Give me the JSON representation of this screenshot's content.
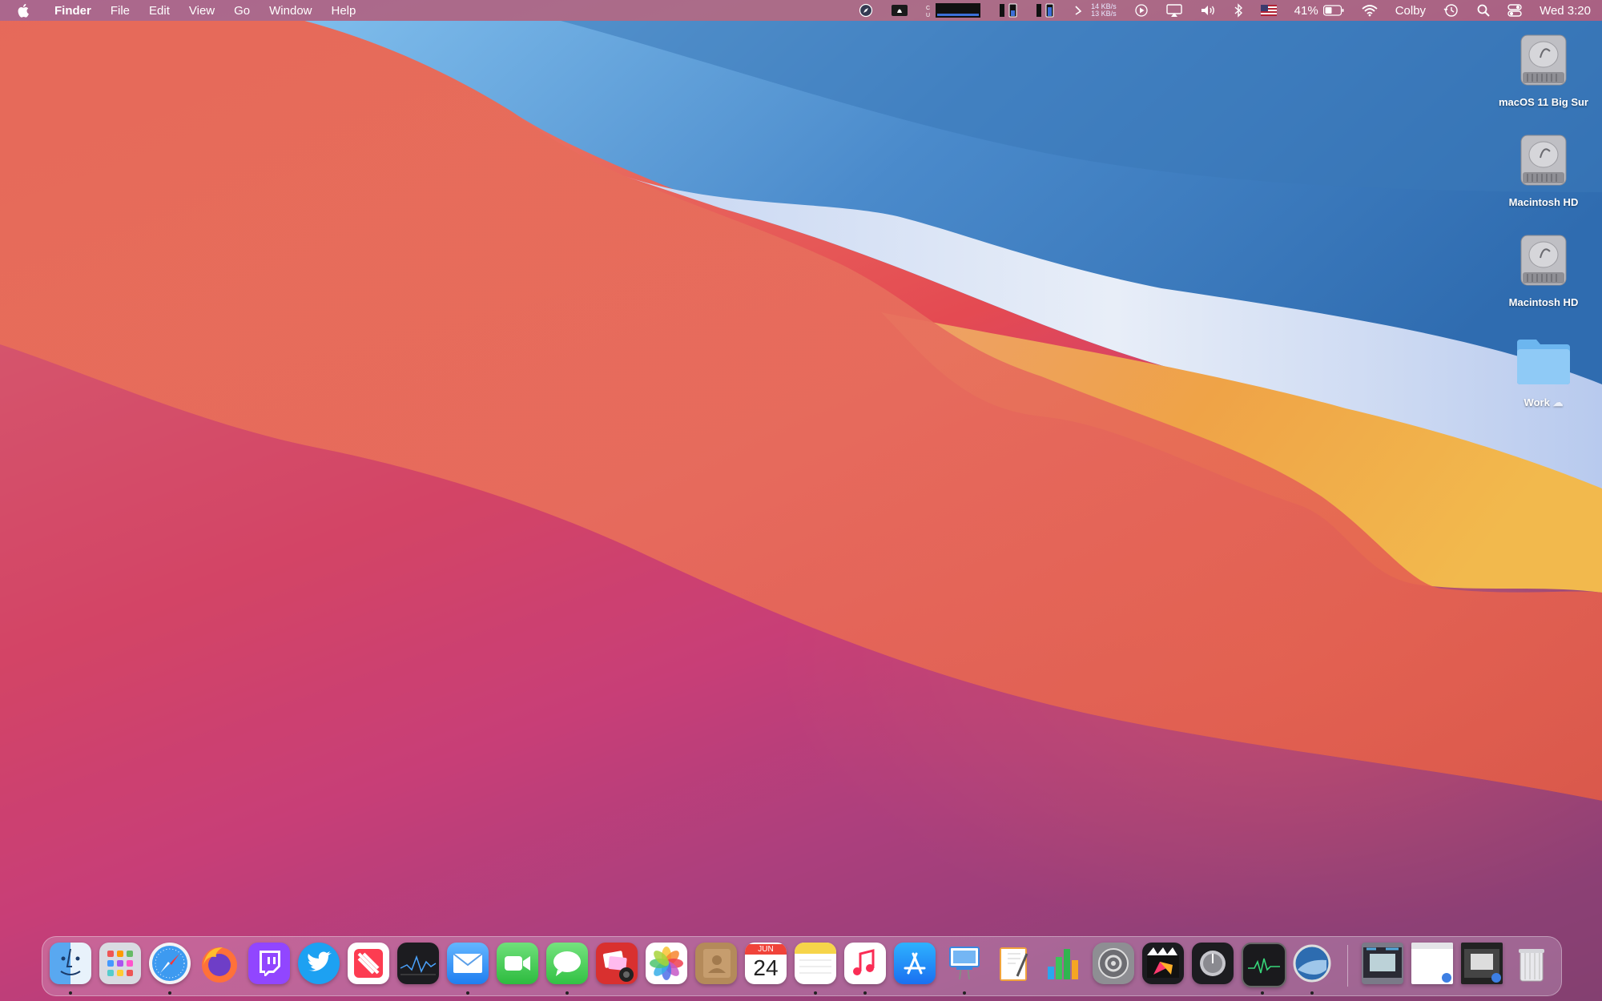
{
  "menubar": {
    "app_name": "Finder",
    "menus": [
      "File",
      "Edit",
      "View",
      "Go",
      "Window",
      "Help"
    ],
    "network_up": "14 KB/s",
    "network_down": "13 KB/s",
    "battery_percent": "41%",
    "user_name": "Colby",
    "clock": "Wed 3:20"
  },
  "desktop_icons": [
    {
      "label": "macOS 11 Big Sur",
      "icon": "hard-drive-icon"
    },
    {
      "label": "Macintosh HD",
      "icon": "hard-drive-icon"
    },
    {
      "label": "Macintosh HD",
      "icon": "hard-drive-icon"
    },
    {
      "label": "Work",
      "icon": "folder-icon"
    }
  ],
  "dock": {
    "apps": [
      {
        "name": "finder",
        "running": true
      },
      {
        "name": "launchpad",
        "running": false
      },
      {
        "name": "safari",
        "running": true
      },
      {
        "name": "firefox",
        "running": false
      },
      {
        "name": "twitch",
        "running": false
      },
      {
        "name": "twitter",
        "running": false
      },
      {
        "name": "news",
        "running": false
      },
      {
        "name": "stocks",
        "running": false
      },
      {
        "name": "mail",
        "running": true
      },
      {
        "name": "facetime",
        "running": false
      },
      {
        "name": "messages",
        "running": true
      },
      {
        "name": "photo-booth",
        "running": false
      },
      {
        "name": "photos",
        "running": false
      },
      {
        "name": "contacts",
        "running": false
      },
      {
        "name": "calendar",
        "running": false
      },
      {
        "name": "notes",
        "running": true
      },
      {
        "name": "music",
        "running": true
      },
      {
        "name": "app-store",
        "running": false
      },
      {
        "name": "keynote",
        "running": true
      },
      {
        "name": "pages",
        "running": false
      },
      {
        "name": "numbers",
        "running": false
      },
      {
        "name": "system-preferences",
        "running": false
      },
      {
        "name": "final-cut-pro",
        "running": false
      },
      {
        "name": "logic-pro",
        "running": false
      },
      {
        "name": "activity-monitor",
        "running": true
      },
      {
        "name": "macos-installer",
        "running": true
      }
    ],
    "calendar_month": "JUN",
    "calendar_day": "24"
  },
  "colors": {
    "menubar": "#7a70b0",
    "wall_blue": "#3f7fc0",
    "wall_light": "#d8e4f5",
    "wall_orange": "#efa548",
    "wall_red": "#e5504f"
  }
}
